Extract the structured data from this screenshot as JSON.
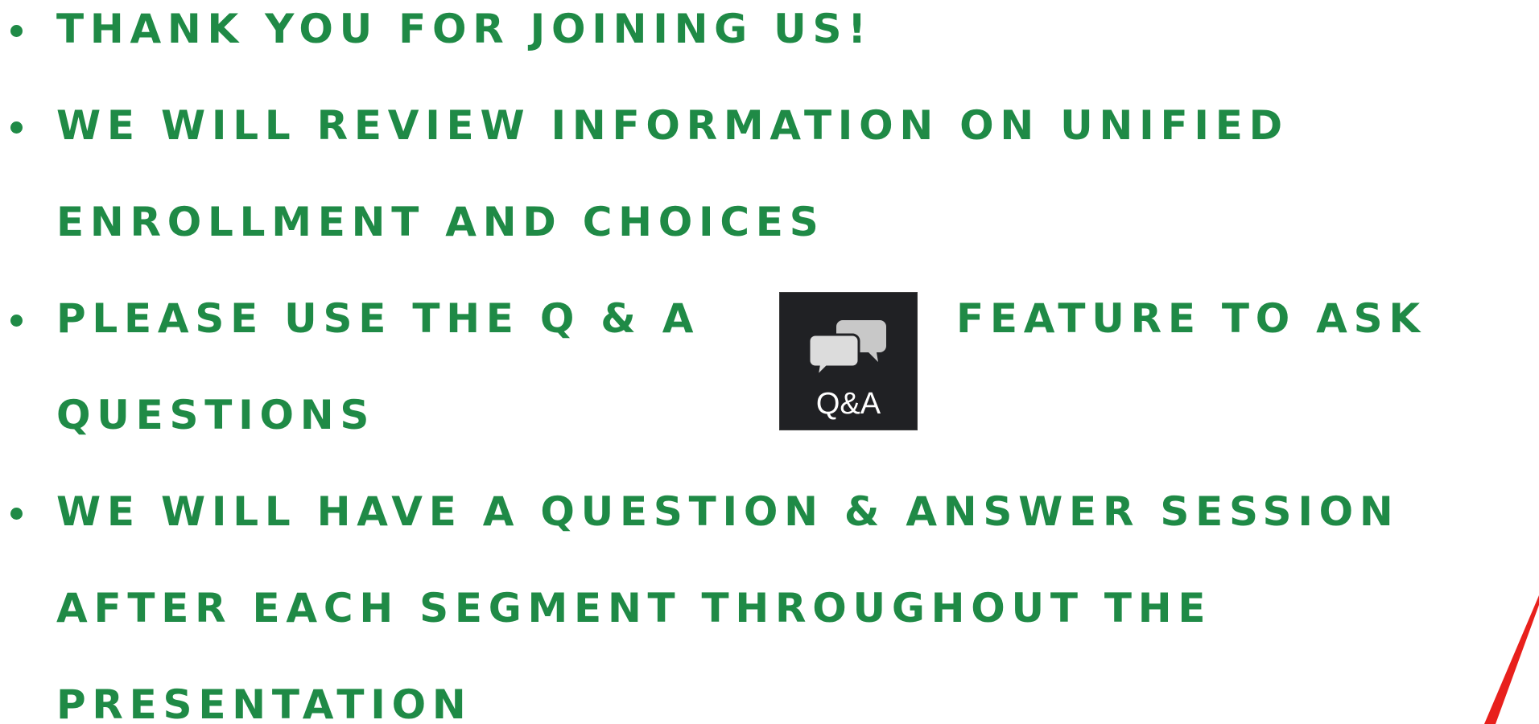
{
  "bullets": [
    {
      "lines": [
        "THANK YOU FOR JOINING US!"
      ]
    },
    {
      "lines": [
        "WE WILL REVIEW INFORMATION ON UNIFIED",
        "ENROLLMENT AND CHOICES"
      ]
    },
    {
      "lines": [
        "PLEASE USE THE Q & A",
        "QUESTIONS"
      ],
      "after_icon": "FEATURE TO ASK"
    },
    {
      "lines": [
        "WE WILL HAVE A QUESTION & ANSWER SESSION",
        "AFTER EACH SEGMENT THROUGHOUT THE",
        "PRESENTATION"
      ]
    }
  ],
  "qa_button": {
    "label": "Q&A",
    "icon": "chat-bubbles-icon"
  },
  "colors": {
    "text": "#1f8a46",
    "button_bg": "#202124",
    "accent_red": "#e8201c"
  }
}
